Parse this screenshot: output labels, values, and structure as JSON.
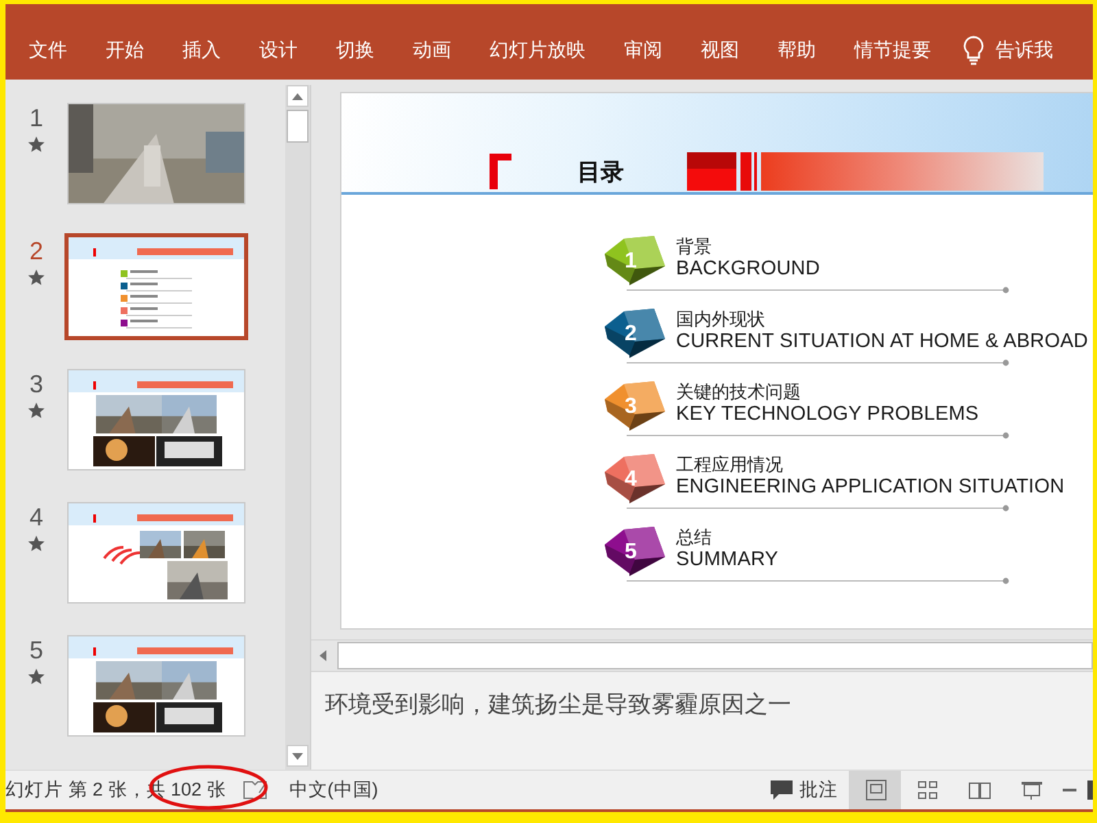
{
  "ribbon": {
    "tabs": [
      {
        "label": "文件",
        "selected": false
      },
      {
        "label": "开始",
        "selected": false
      },
      {
        "label": "插入",
        "selected": false
      },
      {
        "label": "设计",
        "selected": false
      },
      {
        "label": "切换",
        "selected": false
      },
      {
        "label": "动画",
        "selected": false
      },
      {
        "label": "幻灯片放映",
        "selected": false
      },
      {
        "label": "审阅",
        "selected": false
      },
      {
        "label": "视图",
        "selected": false
      },
      {
        "label": "帮助",
        "selected": false
      },
      {
        "label": "情节提要",
        "selected": false
      }
    ],
    "tell_me": "告诉我"
  },
  "thumbnails": [
    {
      "number": "1",
      "kind": "photo",
      "selected": false
    },
    {
      "number": "2",
      "kind": "toc",
      "selected": true
    },
    {
      "number": "3",
      "kind": "gallery",
      "selected": false
    },
    {
      "number": "4",
      "kind": "mixed",
      "selected": false
    },
    {
      "number": "5",
      "kind": "gallery",
      "selected": false
    }
  ],
  "slide": {
    "title": "目录",
    "items": [
      {
        "number": "1",
        "title": "背景",
        "subtitle": "BACKGROUND",
        "color": "#8fc31f"
      },
      {
        "number": "2",
        "title": "国内外现状",
        "subtitle": "CURRENT SITUATION AT HOME & ABROAD",
        "color": "#0b5f8f"
      },
      {
        "number": "3",
        "title": "关键的技术问题",
        "subtitle": "KEY TECHNOLOGY PROBLEMS",
        "color": "#f0902e"
      },
      {
        "number": "4",
        "title": "工程应用情况",
        "subtitle": "ENGINEERING APPLICATION SITUATION",
        "color": "#ee7060"
      },
      {
        "number": "5",
        "title": "总结",
        "subtitle": "SUMMARY",
        "color": "#8e0e8e"
      }
    ]
  },
  "notes": "环境受到影响，建筑扬尘是导致雾霾原因之一",
  "status_bar": {
    "slide_info": "幻灯片 第 2 张，共 102 张",
    "highlight": true,
    "language": "中文(中国)",
    "comments": "批注",
    "views": [
      {
        "kind": "normal",
        "selected": true
      },
      {
        "kind": "sorter",
        "selected": false
      },
      {
        "kind": "reading",
        "selected": false
      },
      {
        "kind": "show",
        "selected": false
      }
    ]
  }
}
